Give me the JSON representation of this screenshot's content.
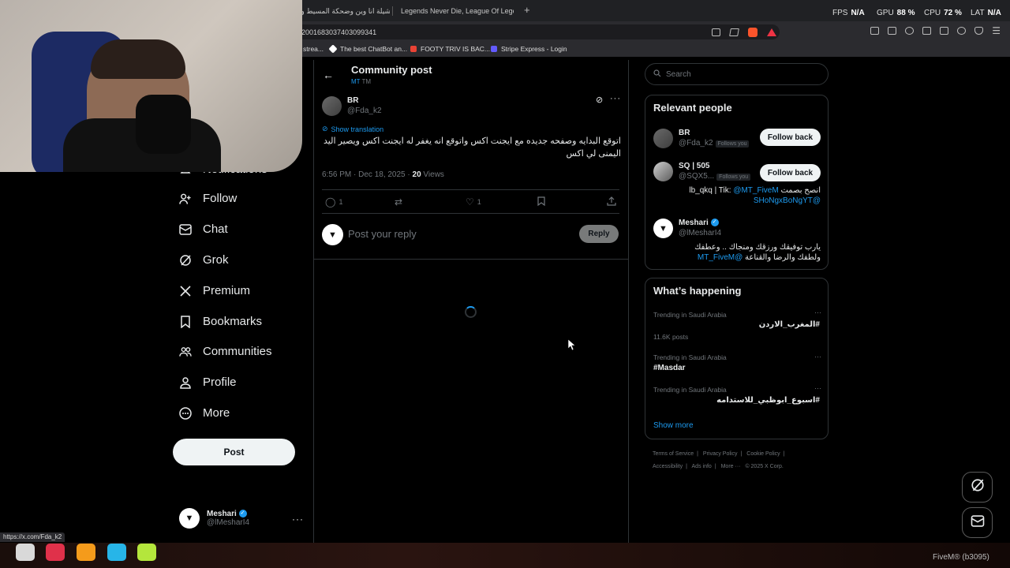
{
  "browser": {
    "tabs": [
      {
        "label": "شيلة انا وين وضحكة المسيط وين"
      },
      {
        "label": "Legends Never Die, League Of Legends"
      }
    ],
    "new_tab": "+",
    "url": "2001683037403099341",
    "hud": [
      {
        "label": "FPS",
        "value": "N/A"
      },
      {
        "label": "GPU",
        "value": "88 %"
      },
      {
        "label": "CPU",
        "value": "72 %"
      },
      {
        "label": "LAT",
        "value": "N/A"
      }
    ],
    "bookmarks": [
      {
        "label": "strea...",
        "color": "#4b7bd8"
      },
      {
        "label": "The best ChatBot an...",
        "color": "#ffffff"
      },
      {
        "label": "FOOTY TRIV IS BAC...",
        "color": "#ea4335"
      },
      {
        "label": "Stripe Express - Login",
        "color": "#635bff"
      }
    ],
    "status_url": "https://x.com/Fda_k2"
  },
  "nav": {
    "items": [
      {
        "label": "Notifications",
        "icon": "bell-icon"
      },
      {
        "label": "Follow",
        "icon": "add-person-icon"
      },
      {
        "label": "Chat",
        "icon": "mail-icon"
      },
      {
        "label": "Grok",
        "icon": "grok-icon"
      },
      {
        "label": "Premium",
        "icon": "x-logo-icon"
      },
      {
        "label": "Bookmarks",
        "icon": "bookmark-icon"
      },
      {
        "label": "Communities",
        "icon": "people-icon"
      },
      {
        "label": "Profile",
        "icon": "person-icon"
      },
      {
        "label": "More",
        "icon": "more-circle-icon"
      }
    ],
    "post_button": "Post",
    "account": {
      "name": "Meshari",
      "handle": "@lMesharI4"
    }
  },
  "main": {
    "title": "Community post",
    "community": "MT",
    "community_suffix": "TM",
    "author": {
      "name": "BR",
      "handle": "@Fda_k2"
    },
    "show_translation": "Show translation",
    "text": "اتوقع البدايه وصفحه جديده مع ايجنت اكس واتوقع انه يغفر له ايجنت اكس ويصير اليد اليمنى لي اكس",
    "time": "6:56 PM · Dec 18, 2025 · ",
    "views_count": "20",
    "views_label": " Views",
    "replies": "1",
    "likes": "1",
    "reply_placeholder": "Post your reply",
    "reply_button": "Reply"
  },
  "right": {
    "search_placeholder": "Search",
    "relevant_title": "Relevant people",
    "people": [
      {
        "name": "BR",
        "handle": "@Fda_k2",
        "follows_you": "Follows you",
        "button": "Follow back"
      },
      {
        "name": "SQ | 505",
        "handle": "@SQX5...",
        "follows_you": "Follows you",
        "button": "Follow back",
        "bio_prefix": "انصح بصمت lb_qkq | Tik: ",
        "bio_link1": "@MT_FiveM",
        "bio_link2": "@SHoNgxBoNgYT"
      },
      {
        "name": "Meshari",
        "handle": "@lMesharI4",
        "bio": "يارب توفيقك ورزقك ومنجاك .. وعطفك ولطفك والرضا والقناعة ",
        "bio_link": "@MT_FiveM"
      }
    ],
    "happening_title": "What’s happening",
    "trends": [
      {
        "context": "Trending in Saudi Arabia",
        "tag": "#المغرب_الاردن",
        "posts": "11.6K posts"
      },
      {
        "context": "Trending in Saudi Arabia",
        "tag": "#Masdar"
      },
      {
        "context": "Trending in Saudi Arabia",
        "tag": "#اسبوع_ابوظبي_للاستدامه"
      }
    ],
    "show_more": "Show more",
    "footer": [
      "Terms of Service",
      "Privacy Policy",
      "Cookie Policy",
      "Accessibility",
      "Ads info",
      "More ···",
      "© 2025 X Corp."
    ]
  },
  "taskbar": {
    "fivem": "FiveM® (b3095)"
  },
  "colors": {
    "accent": "#1d9bf0",
    "background": "#000000",
    "border": "#2f3336"
  }
}
